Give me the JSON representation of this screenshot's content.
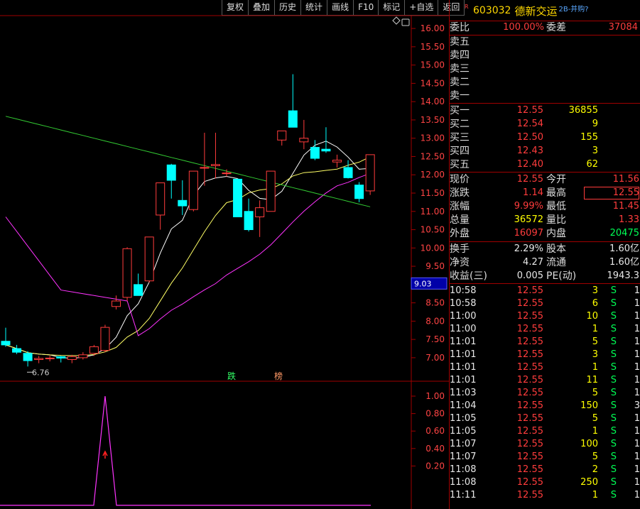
{
  "toolbar": [
    {
      "key": "fuquan",
      "label": "复权"
    },
    {
      "key": "diejia",
      "label": "叠加"
    },
    {
      "key": "lishi",
      "label": "历史"
    },
    {
      "key": "tongji",
      "label": "统计"
    },
    {
      "key": "huaxian",
      "label": "画线"
    },
    {
      "key": "f10",
      "label": "F10"
    },
    {
      "key": "biaoji",
      "label": "标记"
    },
    {
      "key": "zixuan",
      "label": "+自选"
    },
    {
      "key": "fanhui",
      "label": "返回"
    }
  ],
  "stock": {
    "marker": "R",
    "code": "603032",
    "name": "德新交运",
    "tag": "2B-并购?"
  },
  "weibi": {
    "label1": "委比",
    "value1": "100.00%",
    "label2": "委差",
    "value2": "37084"
  },
  "sell_orders": [
    {
      "label": "卖五"
    },
    {
      "label": "卖四"
    },
    {
      "label": "卖三"
    },
    {
      "label": "卖二"
    },
    {
      "label": "卖一"
    }
  ],
  "buy_orders": [
    {
      "label": "买一",
      "price": "12.55",
      "vol": "36855"
    },
    {
      "label": "买二",
      "price": "12.54",
      "vol": "9"
    },
    {
      "label": "买三",
      "price": "12.50",
      "vol": "155"
    },
    {
      "label": "买四",
      "price": "12.43",
      "vol": "3"
    },
    {
      "label": "买五",
      "price": "12.40",
      "vol": "62"
    }
  ],
  "quote": [
    {
      "l1": "现价",
      "v1": "12.55",
      "c1": "up",
      "l2": "今开",
      "v2": "11.56",
      "c2": "up"
    },
    {
      "l1": "涨跌",
      "v1": "1.14",
      "c1": "up",
      "l2": "最高",
      "v2": "12.55",
      "c2": "up"
    },
    {
      "l1": "涨幅",
      "v1": "9.99%",
      "c1": "up",
      "l2": "最低",
      "v2": "11.45",
      "c2": "up"
    },
    {
      "l1": "总量",
      "v1": "36572",
      "c1": "yel",
      "l2": "量比",
      "v2": "1.33",
      "c2": "up"
    },
    {
      "l1": "外盘",
      "v1": "16097",
      "c1": "up",
      "l2": "内盘",
      "v2": "20475",
      "c2": "down"
    }
  ],
  "fundamentals": [
    {
      "l1": "换手",
      "v1": "2.29%",
      "l2": "股本",
      "v2": "1.60亿"
    },
    {
      "l1": "净资",
      "v1": "4.27",
      "l2": "流通",
      "v2": "1.60亿"
    },
    {
      "l1": "收益(三)",
      "v1": "0.005",
      "l2": "PE(动)",
      "v2": "1943.3"
    }
  ],
  "ticks": [
    {
      "time": "10:58",
      "price": "12.55",
      "vol": "3",
      "side": "S",
      "n": "1"
    },
    {
      "time": "10:58",
      "price": "12.55",
      "vol": "6",
      "side": "S",
      "n": "1"
    },
    {
      "time": "11:00",
      "price": "12.55",
      "vol": "10",
      "side": "S",
      "n": "1"
    },
    {
      "time": "11:00",
      "price": "12.55",
      "vol": "1",
      "side": "S",
      "n": "1"
    },
    {
      "time": "11:01",
      "price": "12.55",
      "vol": "5",
      "side": "S",
      "n": "1"
    },
    {
      "time": "11:01",
      "price": "12.55",
      "vol": "3",
      "side": "S",
      "n": "1"
    },
    {
      "time": "11:01",
      "price": "12.55",
      "vol": "1",
      "side": "S",
      "n": "1"
    },
    {
      "time": "11:01",
      "price": "12.55",
      "vol": "11",
      "side": "S",
      "n": "1"
    },
    {
      "time": "11:03",
      "price": "12.55",
      "vol": "5",
      "side": "S",
      "n": "1"
    },
    {
      "time": "11:04",
      "price": "12.55",
      "vol": "150",
      "side": "S",
      "n": "3"
    },
    {
      "time": "11:05",
      "price": "12.55",
      "vol": "5",
      "side": "S",
      "n": "1"
    },
    {
      "time": "11:05",
      "price": "12.55",
      "vol": "1",
      "side": "S",
      "n": "1"
    },
    {
      "time": "11:07",
      "price": "12.55",
      "vol": "100",
      "side": "S",
      "n": "1"
    },
    {
      "time": "11:07",
      "price": "12.55",
      "vol": "5",
      "side": "S",
      "n": "1"
    },
    {
      "time": "11:08",
      "price": "12.55",
      "vol": "2",
      "side": "S",
      "n": "1"
    },
    {
      "time": "11:08",
      "price": "12.55",
      "vol": "250",
      "side": "S",
      "n": "1"
    },
    {
      "time": "11:11",
      "price": "12.55",
      "vol": "1",
      "side": "S",
      "n": "1"
    }
  ],
  "colors": {
    "up": "#ff3c3c",
    "down": "#00ffff",
    "ma5": "#ffffff",
    "ma10": "#ffff66",
    "ma20": "#ff33ff",
    "ma60": "#33cc33",
    "indicator": "#ff33ff",
    "gridline": "#a00000"
  },
  "chart_data": {
    "type": "candlestick",
    "price_axis": {
      "ticks": [
        "16.00",
        "15.50",
        "15.00",
        "14.50",
        "14.00",
        "13.50",
        "13.00",
        "12.50",
        "12.00",
        "11.50",
        "11.00",
        "10.50",
        "10.00",
        "9.50",
        "9.00",
        "8.50",
        "8.00",
        "7.50",
        "7.00"
      ],
      "range": [
        6.5,
        16.3
      ]
    },
    "cursor_label": "9.03",
    "low_marker": "6.76",
    "candles": [
      {
        "o": 7.45,
        "h": 7.82,
        "l": 7.3,
        "c": 7.35
      },
      {
        "o": 7.25,
        "h": 7.35,
        "l": 7.1,
        "c": 7.15
      },
      {
        "o": 7.12,
        "h": 7.18,
        "l": 6.76,
        "c": 6.92
      },
      {
        "o": 6.95,
        "h": 7.05,
        "l": 6.85,
        "c": 6.98
      },
      {
        "o": 6.98,
        "h": 7.06,
        "l": 6.9,
        "c": 6.99
      },
      {
        "o": 7.03,
        "h": 7.05,
        "l": 6.87,
        "c": 6.99
      },
      {
        "o": 6.95,
        "h": 7.08,
        "l": 6.85,
        "c": 7.03
      },
      {
        "o": 7.0,
        "h": 7.15,
        "l": 6.95,
        "c": 7.08
      },
      {
        "o": 7.12,
        "h": 7.35,
        "l": 7.05,
        "c": 7.3
      },
      {
        "o": 7.2,
        "h": 7.9,
        "l": 7.15,
        "c": 7.83
      },
      {
        "o": 8.4,
        "h": 8.7,
        "l": 8.32,
        "c": 8.55
      },
      {
        "o": 8.65,
        "h": 10.02,
        "l": 8.55,
        "c": 9.98
      },
      {
        "o": 9.0,
        "h": 9.3,
        "l": 8.7,
        "c": 8.7
      },
      {
        "o": 9.1,
        "h": 10.3,
        "l": 9.05,
        "c": 10.3
      },
      {
        "o": 10.9,
        "h": 11.5,
        "l": 10.5,
        "c": 11.78
      },
      {
        "o": 12.27,
        "h": 12.3,
        "l": 11.35,
        "c": 11.85
      },
      {
        "o": 11.3,
        "h": 11.85,
        "l": 10.9,
        "c": 11.15
      },
      {
        "o": 11.05,
        "h": 12.1,
        "l": 11.0,
        "c": 12.1
      },
      {
        "o": 12.2,
        "h": 13.15,
        "l": 11.7,
        "c": 12.2
      },
      {
        "o": 12.25,
        "h": 13.15,
        "l": 11.9,
        "c": 12.28
      },
      {
        "o": 12.05,
        "h": 12.15,
        "l": 11.95,
        "c": 12.05
      },
      {
        "o": 11.88,
        "h": 11.9,
        "l": 10.85,
        "c": 10.85
      },
      {
        "o": 11.0,
        "h": 11.35,
        "l": 10.45,
        "c": 10.5
      },
      {
        "o": 10.85,
        "h": 11.3,
        "l": 10.3,
        "c": 11.1
      },
      {
        "o": 11.0,
        "h": 12.1,
        "l": 11.0,
        "c": 12.1
      },
      {
        "o": 12.95,
        "h": 13.2,
        "l": 12.8,
        "c": 13.2
      },
      {
        "o": 13.75,
        "h": 14.75,
        "l": 13.3,
        "c": 13.3
      },
      {
        "o": 12.9,
        "h": 13.5,
        "l": 12.7,
        "c": 13.0
      },
      {
        "o": 12.75,
        "h": 12.95,
        "l": 12.4,
        "c": 12.45
      },
      {
        "o": 12.7,
        "h": 13.3,
        "l": 12.6,
        "c": 12.65
      },
      {
        "o": 12.35,
        "h": 12.55,
        "l": 12.2,
        "c": 12.4
      },
      {
        "o": 12.2,
        "h": 12.4,
        "l": 11.9,
        "c": 11.92
      },
      {
        "o": 11.72,
        "h": 11.8,
        "l": 11.25,
        "c": 11.35
      },
      {
        "o": 11.56,
        "h": 12.55,
        "l": 11.45,
        "c": 12.55
      }
    ],
    "signals": [
      {
        "text": "跌"
      },
      {
        "text": "榜"
      }
    ],
    "indicator": {
      "ticks": [
        "1.00",
        "0.80",
        "0.60",
        "0.40",
        "0.20"
      ],
      "range": [
        0,
        1.05
      ],
      "peak_value": 1.0
    }
  }
}
